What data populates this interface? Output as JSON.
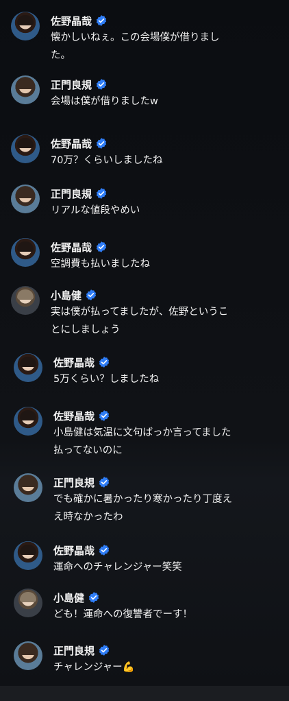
{
  "comments": [
    {
      "name": "佐野晶哉",
      "text": "懐かしいねぇ。この会場僕が借りまし\nた。"
    },
    {
      "name": "正門良規",
      "text": "会場は僕が借りましたw"
    },
    {
      "name": "佐野晶哉",
      "text": "70万？くらいしましたね"
    },
    {
      "name": "正門良規",
      "text": "リアルな値段やめい"
    },
    {
      "name": "佐野晶哉",
      "text": "空調費も払いましたね"
    },
    {
      "name": "小島健",
      "text": "実は僕が払ってましたが、佐野というこ\nとにしましょう"
    },
    {
      "name": "佐野晶哉",
      "text": "5万くらい？しましたね"
    },
    {
      "name": "佐野晶哉",
      "text": "小島健は気温に文句ばっか言ってました\n払ってないのに"
    },
    {
      "name": "正門良規",
      "text": "でも確かに暑かったり寒かったり丁度え\nえ時なかったわ"
    },
    {
      "name": "佐野晶哉",
      "text": "運命へのチャレンジャー笑笑"
    },
    {
      "name": "小島健",
      "text": "ども！運命への復讐者でーす！"
    },
    {
      "name": "正門良規",
      "text": "チャレンジャー💪"
    }
  ],
  "icons": {
    "verified": "verified-badge-icon",
    "avatar": "avatar"
  },
  "colors": {
    "background": "#0d0f13",
    "verified_badge": "#2f7df6",
    "text": "#f0f0f0"
  }
}
